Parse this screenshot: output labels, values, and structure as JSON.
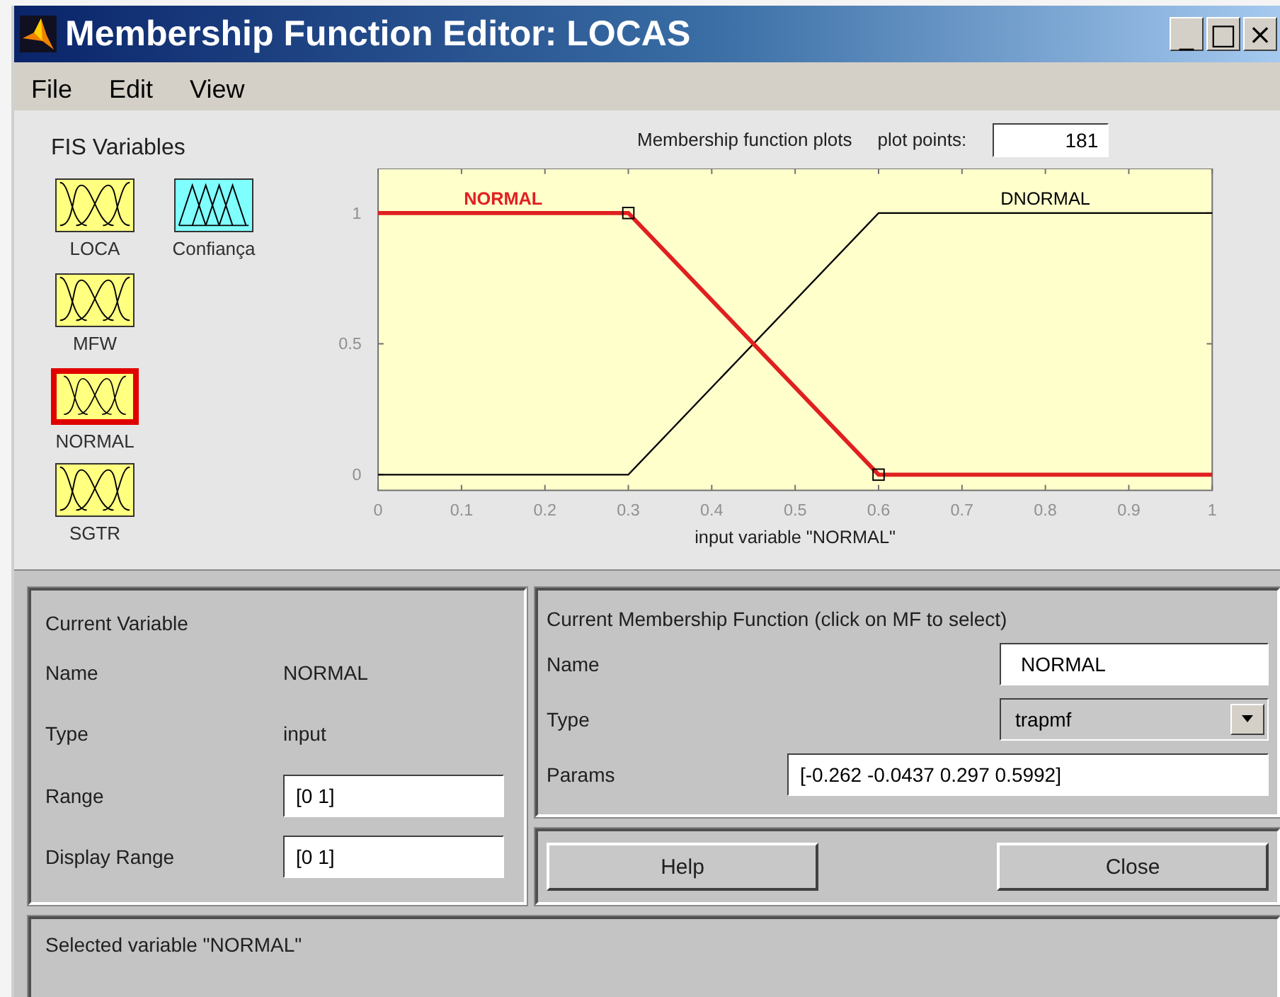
{
  "window": {
    "title": "Membership Function Editor: LOCAS",
    "controls": [
      "_",
      "□",
      "×"
    ]
  },
  "menu": [
    "File",
    "Edit",
    "View"
  ],
  "fis_variables": {
    "title": "FIS Variables",
    "items": [
      {
        "kind": "input",
        "label": "LOCA",
        "color": "#ffff80",
        "selected": false
      },
      {
        "kind": "output",
        "label": "Confiança",
        "color": "#80ffff",
        "selected": false
      },
      {
        "kind": "input",
        "label": "MFW",
        "color": "#ffff80",
        "selected": false
      },
      {
        "kind": "input",
        "label": "NORMAL",
        "color": "#ffff80",
        "selected": true
      },
      {
        "kind": "input",
        "label": "SGTR",
        "color": "#ffff80",
        "selected": false
      }
    ]
  },
  "plot": {
    "curves": [
      {
        "selected": true
      },
      {
        "selected": false
      }
    ],
    "title": "Membership function plots",
    "plot_points_label": "plot points:",
    "plot_points": "181",
    "chart_data": {
      "type": "line",
      "xlabel": "input variable \"NORMAL\"",
      "x": [
        0,
        0.3,
        0.6,
        1
      ],
      "xlim": [
        0,
        1
      ],
      "ylim": [
        -0.06,
        1.17
      ],
      "xticks": [
        0,
        {
          "value": 0.1,
          "label": "0.1"
        },
        {
          "value": 0.2,
          "label": "0.2"
        },
        {
          "value": 0.3,
          "label": "0.3"
        },
        {
          "value": 0.4,
          "label": "0.4"
        },
        {
          "value": 0.5,
          "label": "0.5"
        },
        {
          "value": 0.6,
          "label": "0.6"
        },
        {
          "value": 0.7,
          "label": "0.7"
        },
        {
          "value": 0.8,
          "label": "0.8"
        },
        {
          "value": 0.9,
          "label": "0.9"
        },
        1
      ],
      "yticks": [
        0,
        {
          "value": 0.5,
          "label": "0.5"
        },
        1
      ],
      "series": [
        {
          "name": "NORMAL",
          "color": "#e02020",
          "values": [
            1,
            1,
            0,
            0
          ]
        },
        {
          "name": "DNORMAL",
          "color": "#000000",
          "values": [
            0,
            0,
            1,
            1
          ]
        }
      ]
    }
  },
  "current_variable": {
    "title": "Current Variable",
    "fields": [
      {
        "kind": "text",
        "label": "Name",
        "value": "NORMAL"
      },
      {
        "kind": "text",
        "label": "Type",
        "value": "input"
      },
      {
        "kind": "input",
        "label": "Range",
        "value": "[0 1]"
      },
      {
        "kind": "input",
        "label": "Display Range",
        "value": "[0 1]"
      }
    ]
  },
  "current_mf": {
    "title": "Current Membership Function (click on MF to select)",
    "name_label": "Name",
    "name": "NORMAL",
    "type_label": "Type",
    "type": "trapmf",
    "params_label": "Params",
    "params": "[-0.262 -0.0437 0.297 0.5992]"
  },
  "buttons": [
    "Help",
    "Close"
  ],
  "status_bar": "Selected variable \"NORMAL\""
}
